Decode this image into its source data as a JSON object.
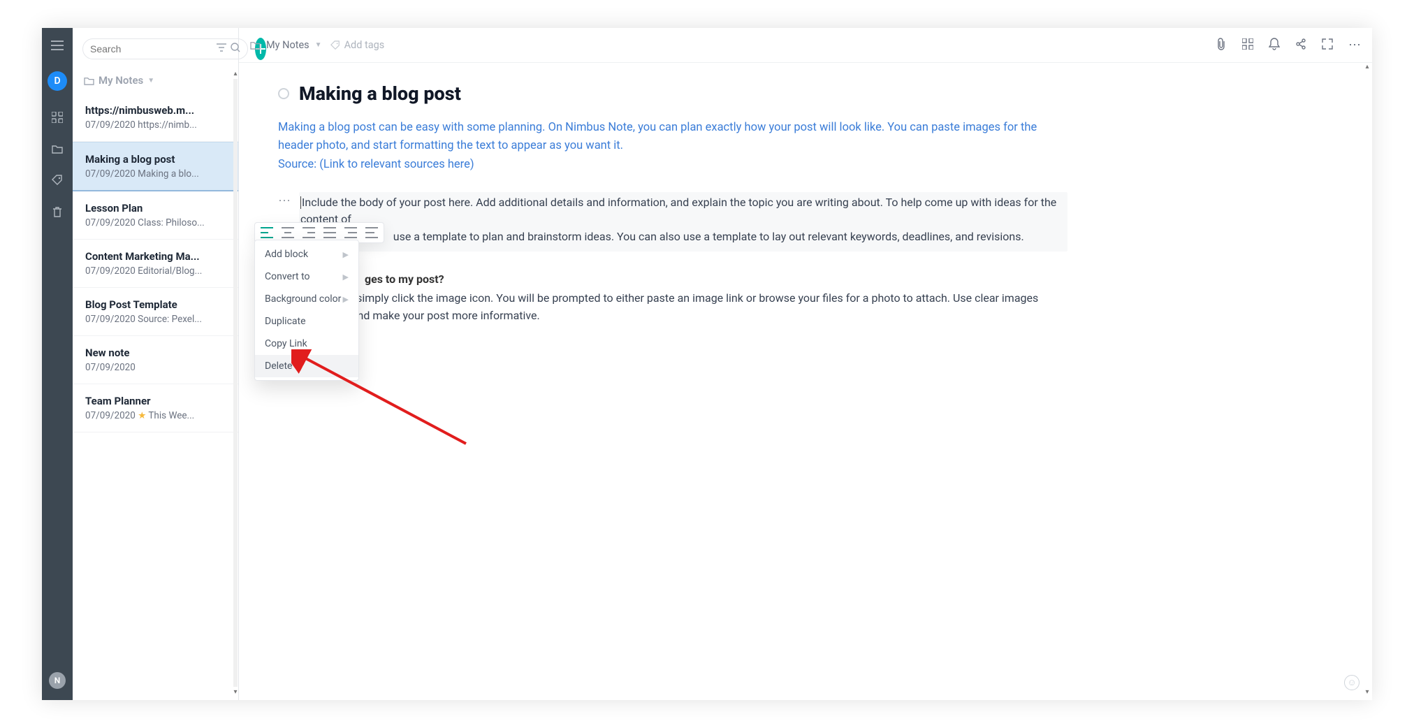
{
  "rail": {
    "avatar_letter": "D",
    "bottom_avatar_letter": "N"
  },
  "search": {
    "placeholder": "Search"
  },
  "sidebar": {
    "folder_label": "My Notes",
    "notes": [
      {
        "title": "https://nimbusweb.m...",
        "sub": "07/09/2020 https://nimb..."
      },
      {
        "title": "Making a blog post",
        "sub": "07/09/2020 Making a blo..."
      },
      {
        "title": "Lesson Plan",
        "sub": "07/09/2020 Class: Philoso..."
      },
      {
        "title": "Content Marketing Ma...",
        "sub": "07/09/2020 Editorial/Blog..."
      },
      {
        "title": "Blog Post Template",
        "sub": "07/09/2020 Source: Pexel..."
      },
      {
        "title": "New note",
        "sub": "07/09/2020"
      },
      {
        "title": "Team Planner",
        "sub_prefix": "07/09/2020 ",
        "sub_suffix": " This Wee..."
      }
    ]
  },
  "topbar": {
    "breadcrumb": "My Notes",
    "tags_placeholder": "Add tags"
  },
  "doc": {
    "title": "Making a blog post",
    "intro": "Making a blog post can be easy with some planning. On Nimbus Note, you can plan exactly how your post will look like. You can paste images for the header photo, and start formatting the text to appear as you want it.",
    "source_line": "Source: (Link to relevant sources here)",
    "body_para": "Include the body of your post here. Add additional details and information, and explain the topic you are writing about. To help come up with ideas for the content of",
    "body_para2_suffix": "use a template to plan and brainstorm ideas. You can also use a template to lay out relevant keywords, deadlines, and revisions.",
    "q_visible_suffix": "ges to my post?",
    "answer_visible_suffix": "images, simply click the image icon. You will be prompted to either paste an image link or browse your files for a photo to attach. Use clear images",
    "answer_line2_suffix": "thout words and make your post more informative."
  },
  "context_menu": {
    "items": [
      {
        "label": "Add block",
        "sub": true
      },
      {
        "label": "Convert to",
        "sub": true
      },
      {
        "label": "Background color",
        "sub": true
      },
      {
        "label": "Duplicate",
        "sub": false
      },
      {
        "label": "Copy Link",
        "sub": false
      },
      {
        "label": "Delete",
        "sub": false
      }
    ]
  }
}
